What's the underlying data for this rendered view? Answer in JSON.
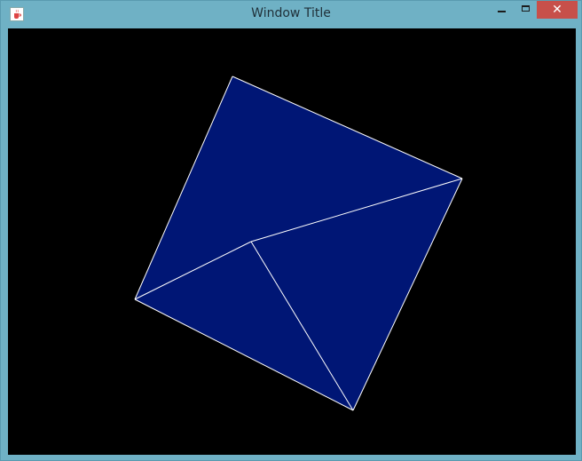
{
  "window": {
    "title": "Window Title",
    "buttons": {
      "minimize": "–",
      "maximize": "□",
      "close": "✕"
    }
  },
  "canvas": {
    "background": "#000000",
    "fill_color": "#001675",
    "edge_color": "#ffffff",
    "icons": {
      "app": "java-cup-icon"
    }
  }
}
